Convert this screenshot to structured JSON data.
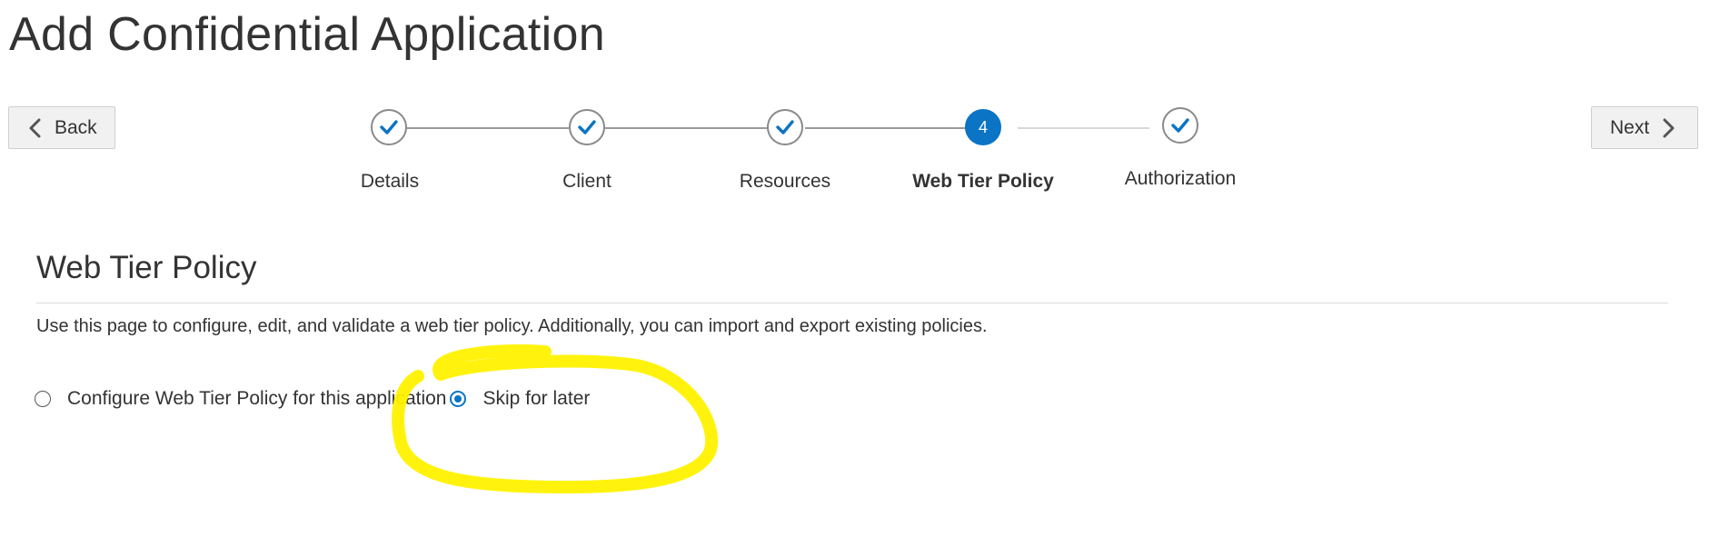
{
  "page": {
    "title": "Add Confidential Application"
  },
  "nav": {
    "back_label": "Back",
    "next_label": "Next"
  },
  "train": {
    "steps": [
      {
        "label": "Details",
        "state": "done"
      },
      {
        "label": "Client",
        "state": "done"
      },
      {
        "label": "Resources",
        "state": "done"
      },
      {
        "label": "Web Tier Policy",
        "state": "current",
        "number": "4"
      },
      {
        "label": "Authorization",
        "state": "done"
      }
    ]
  },
  "section": {
    "title": "Web Tier Policy",
    "description": "Use this page to configure, edit, and validate a web tier policy. Additionally, you can import and export existing policies."
  },
  "options": {
    "configure_label": "Configure Web Tier Policy for this application",
    "configure_checked": false,
    "skip_label": "Skip for later",
    "skip_checked": true
  },
  "colors": {
    "accent": "#0b74c4",
    "highlighter": "#fff200",
    "done_check": "#0b74c4"
  },
  "icons": {
    "back": "chevron-left-icon",
    "next": "chevron-right-icon",
    "done": "checkmark-icon"
  }
}
